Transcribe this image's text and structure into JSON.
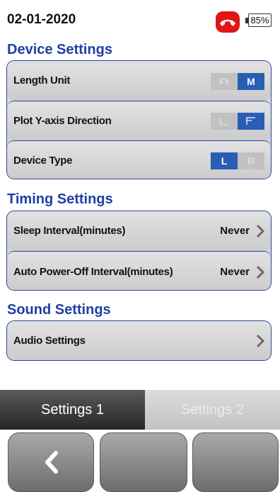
{
  "status": {
    "date": "02-01-2020",
    "battery": "85%"
  },
  "sections": {
    "device": {
      "title": "Device Settings",
      "rows": [
        {
          "label": "Length Unit",
          "options": [
            "Ft",
            "M"
          ],
          "selected": "M"
        },
        {
          "label": "Plot Y-axis Direction",
          "options": [
            "plot-up-icon",
            "plot-down-icon"
          ],
          "selected": "plot-down-icon"
        },
        {
          "label": "Device Type",
          "options": [
            "L",
            "R"
          ],
          "selected": "L"
        }
      ]
    },
    "timing": {
      "title": "Timing Settings",
      "rows": [
        {
          "label": "Sleep Interval(minutes)",
          "value": "Never"
        },
        {
          "label": "Auto Power-Off Interval(minutes)",
          "value": "Never"
        }
      ]
    },
    "sound": {
      "title": "Sound Settings",
      "rows": [
        {
          "label": "Audio Settings"
        }
      ]
    }
  },
  "tabs": [
    {
      "label": "Settings 1",
      "active": true
    },
    {
      "label": "Settings 2",
      "active": false
    }
  ],
  "softkeys": [
    "back-arrow-icon",
    "",
    ""
  ],
  "colors": {
    "accent": "#2a5eb5",
    "section_title": "#1f3fa3",
    "hangup": "#e01515"
  }
}
